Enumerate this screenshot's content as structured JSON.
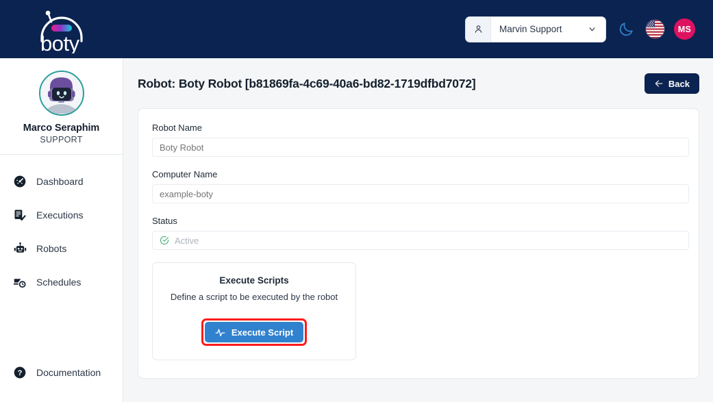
{
  "brand": {
    "logo_text": "boty",
    "logo_icon": "robot-head-logo",
    "gradient_from": "#e91e8c",
    "gradient_to": "#17c8d8",
    "topbar_color": "#0b2350"
  },
  "topbar": {
    "user_select": {
      "icon": "person-icon",
      "value": "Marvin Support",
      "chevron": "chevron-down-icon"
    },
    "theme_toggle": {
      "icon": "moon-icon",
      "label": "Dark mode"
    },
    "language": {
      "icon": "us-flag-icon",
      "label": "English (US)"
    },
    "avatar": {
      "initials": "MS",
      "color": "#dd1260"
    }
  },
  "sidebar": {
    "profile": {
      "avatar_icon": "robot-avatar",
      "name": "Marco Seraphim",
      "role": "SUPPORT",
      "ring_color": "#2a9d9b"
    },
    "items": [
      {
        "label": "Dashboard",
        "icon": "gauge-icon"
      },
      {
        "label": "Executions",
        "icon": "list-check-icon"
      },
      {
        "label": "Robots",
        "icon": "robot-icon"
      },
      {
        "label": "Schedules",
        "icon": "schedule-clock-icon"
      }
    ],
    "bottom_items": [
      {
        "label": "Documentation",
        "icon": "question-circle-icon"
      }
    ]
  },
  "main": {
    "page_title": "Robot: Boty Robot [b81869fa-4c69-40a6-bd82-1719dfbd7072]",
    "back_button": {
      "label": "Back",
      "icon": "arrow-left-icon"
    },
    "fields": [
      {
        "label": "Robot Name",
        "placeholder": "Boty Robot",
        "value": ""
      },
      {
        "label": "Computer Name",
        "placeholder": "example-boty",
        "value": ""
      }
    ],
    "status_field": {
      "label": "Status",
      "icon": "check-circle-icon",
      "icon_color": "#4caf7d",
      "value": "Active"
    },
    "execute_card": {
      "title": "Execute Scripts",
      "subtitle": "Define a script to be executed by the robot",
      "button": {
        "label": "Execute Script",
        "icon": "activity-pulse-icon",
        "color": "#3182ce",
        "highlight_color": "#fd1a1a"
      }
    }
  }
}
